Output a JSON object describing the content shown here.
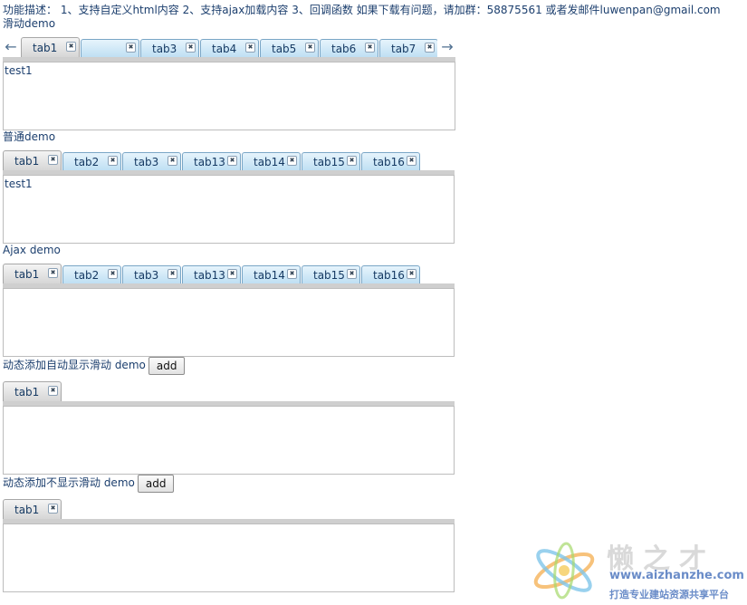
{
  "header": {
    "description": "功能描述： 1、支持自定义html内容 2、支持ajax加载内容 3、回调函数 如果下载有问题，请加群：58875561 或者发邮件luwenpan@gmail.com"
  },
  "scroll_demo": {
    "title": "滑动demo",
    "tabs": [
      "tab1",
      "",
      "tab3",
      "tab4",
      "tab5",
      "tab6",
      "tab7"
    ],
    "content": "test1"
  },
  "normal_demo": {
    "title": "普通demo",
    "tabs": [
      "tab1",
      "tab2",
      "tab3",
      "tab13",
      "tab14",
      "tab15",
      "tab16"
    ],
    "content": "test1"
  },
  "ajax_demo": {
    "title": "Ajax demo",
    "tabs": [
      "tab1",
      "tab2",
      "tab3",
      "tab13",
      "tab14",
      "tab15",
      "tab16"
    ],
    "content": ""
  },
  "dynamic_scroll_demo": {
    "title": "动态添加自动显示滑动 demo",
    "button": "add",
    "tabs": [
      "tab1"
    ]
  },
  "dynamic_noscroll_demo": {
    "title": "动态添加不显示滑动 demo",
    "button": "add",
    "tabs": [
      "tab1"
    ]
  },
  "icons": {
    "left_arrow": "arrow-left-icon",
    "right_arrow": "arrow-right-icon",
    "close": "close-icon"
  },
  "watermark": {
    "brand": "懒之才",
    "url": "www.aizhanzhe.com",
    "slogan": "打造专业建站资源共享平台"
  }
}
